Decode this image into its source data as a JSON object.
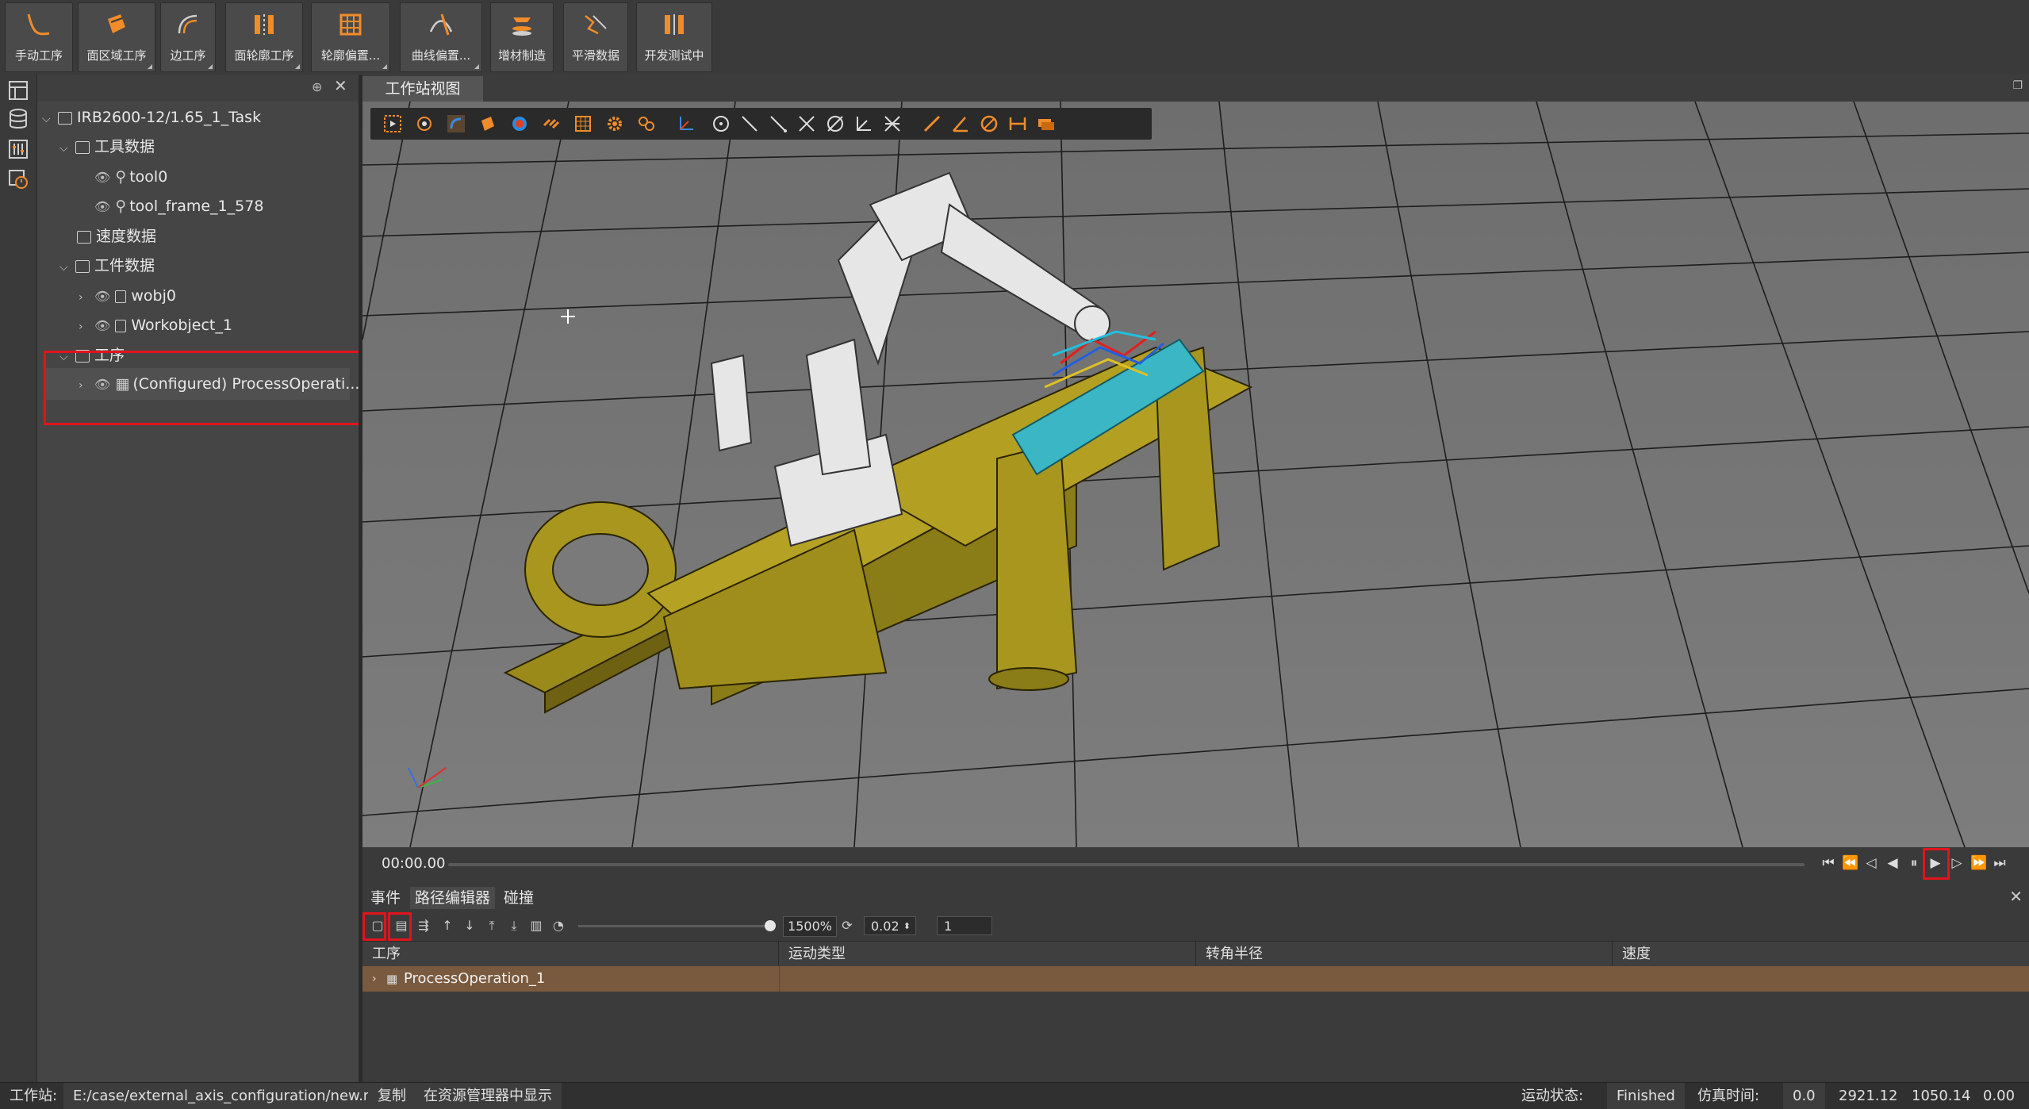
{
  "ribbon": {
    "buttons": [
      {
        "label": "手动工序",
        "icon": "curve-icon"
      },
      {
        "label": "面区域工序",
        "icon": "surface-region-icon"
      },
      {
        "label": "边工序",
        "icon": "edge-icon"
      },
      {
        "label": "面轮廓工序",
        "icon": "surface-contour-icon"
      },
      {
        "label": "轮廓偏置...",
        "icon": "contour-offset-icon"
      },
      {
        "label": "曲线偏置...",
        "icon": "curve-offset-icon"
      },
      {
        "label": "增材制造",
        "icon": "additive-icon"
      },
      {
        "label": "平滑数据",
        "icon": "smooth-icon"
      },
      {
        "label": "开发测试中",
        "icon": "dev-test-icon"
      }
    ]
  },
  "tree": {
    "items": [
      {
        "label": "IRB2600-12/1.65_1_Task"
      },
      {
        "label": "工具数据"
      },
      {
        "label": "tool0"
      },
      {
        "label": "tool_frame_1_578"
      },
      {
        "label": "速度数据"
      },
      {
        "label": "工件数据"
      },
      {
        "label": "wobj0"
      },
      {
        "label": "Workobject_1"
      },
      {
        "label": "工序"
      },
      {
        "label": "(Configured) ProcessOperati..."
      }
    ]
  },
  "view": {
    "tab": "工作站视图"
  },
  "timeline": {
    "time": "00:00.00",
    "progress": 0
  },
  "bottom": {
    "tabs": [
      "事件",
      "路径编辑器",
      "碰撞"
    ],
    "speed": "1500%",
    "step": "0.02",
    "count": "1",
    "columns": [
      "工序",
      "运动类型",
      "转角半径",
      "速度"
    ],
    "rows": [
      {
        "name": "ProcessOperation_1"
      }
    ]
  },
  "status": {
    "station_label": "工作站:",
    "path": "E:/case/external_axis_configuration/new.msln",
    "copy": "复制",
    "show_in_explorer": "在资源管理器中显示",
    "motion_label": "运动状态:",
    "motion_value": "Finished",
    "sim_label": "仿真时间:",
    "sim_value": "0.0",
    "coord1": "2921.12",
    "coord2": "1050.14",
    "coord3": "0.00"
  },
  "colors": {
    "accent": "#f08c2a",
    "highlight": "#e0141c",
    "row_selected": "#7a5a3e",
    "yellow_model": "#a8961e",
    "cyan_part": "#3ab6c4"
  }
}
